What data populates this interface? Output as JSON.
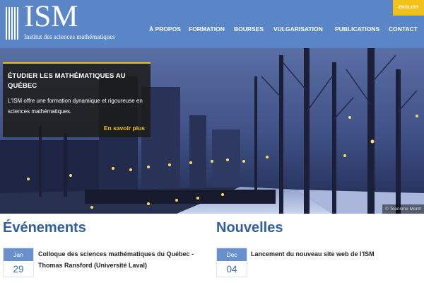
{
  "header": {
    "logo": {
      "name": "ISM",
      "subtitle": "Institut des sciences mathématiques"
    },
    "language_button": "ENGLISH",
    "nav": [
      {
        "label": "À PROPOS"
      },
      {
        "label": "FORMATION"
      },
      {
        "label": "BOURSES"
      },
      {
        "label": "VULGARISATION"
      },
      {
        "label": "PUBLICATIONS"
      },
      {
        "label": "CONTACT"
      }
    ],
    "colors": {
      "header_bg": "#5a86c7",
      "accent": "#f2c21a"
    }
  },
  "hero": {
    "title": "ÉTUDIER LES MATHÉMATIQUES AU QUÉBEC",
    "description": "L'ISM offre une formation dynamique et rigoureuse en sciences mathématiques.",
    "cta": "En savoir plus",
    "photo_credit": "© Tourisme Montr"
  },
  "events": {
    "heading": "Événements",
    "items": [
      {
        "month": "Jan",
        "day": "29",
        "title": "Colloque des sciences mathématiques du Québec - Thomas Ransford (Université Laval)"
      }
    ]
  },
  "news": {
    "heading": "Nouvelles",
    "items": [
      {
        "month": "Dec",
        "day": "04",
        "title": "Lancement du nouveau site web de l'ISM"
      }
    ]
  }
}
